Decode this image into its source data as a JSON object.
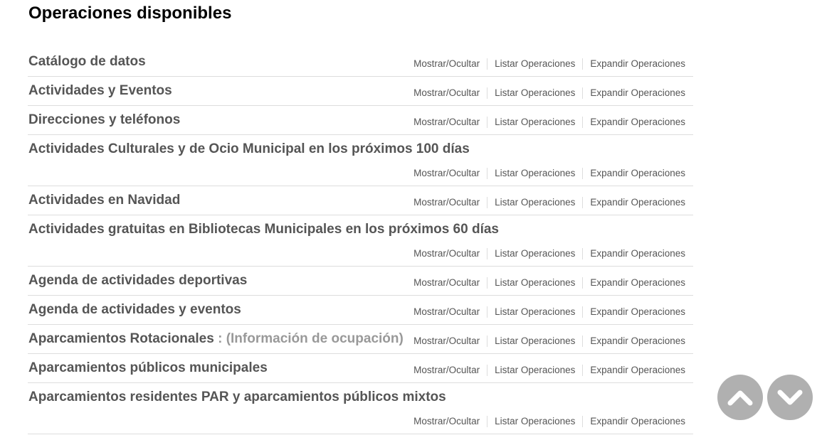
{
  "page": {
    "title": "Operaciones disponibles"
  },
  "link_labels": {
    "show_hide": "Mostrar/Ocultar",
    "list": "Listar Operaciones",
    "expand": "Expandir Operaciones"
  },
  "operations": [
    {
      "title": "Catálogo de datos",
      "subtitle": ""
    },
    {
      "title": "Actividades y Eventos",
      "subtitle": ""
    },
    {
      "title": "Direcciones y teléfonos",
      "subtitle": ""
    },
    {
      "title": "Actividades Culturales y de Ocio Municipal en los próximos 100 días",
      "subtitle": ""
    },
    {
      "title": "Actividades en Navidad",
      "subtitle": ""
    },
    {
      "title": "Actividades gratuitas en Bibliotecas Municipales en los próximos 60 días",
      "subtitle": ""
    },
    {
      "title": "Agenda de actividades deportivas",
      "subtitle": ""
    },
    {
      "title": "Agenda de actividades y eventos",
      "subtitle": ""
    },
    {
      "title": "Aparcamientos Rotacionales",
      "subtitle": ": (Información de ocupación)"
    },
    {
      "title": "Aparcamientos públicos municipales",
      "subtitle": ""
    },
    {
      "title": "Aparcamientos residentes PAR y aparcamientos públicos mixtos",
      "subtitle": ""
    }
  ],
  "scroll_buttons": {
    "up_icon": "chevron-up-icon",
    "down_icon": "chevron-down-icon",
    "color": "#b0b0b0"
  }
}
